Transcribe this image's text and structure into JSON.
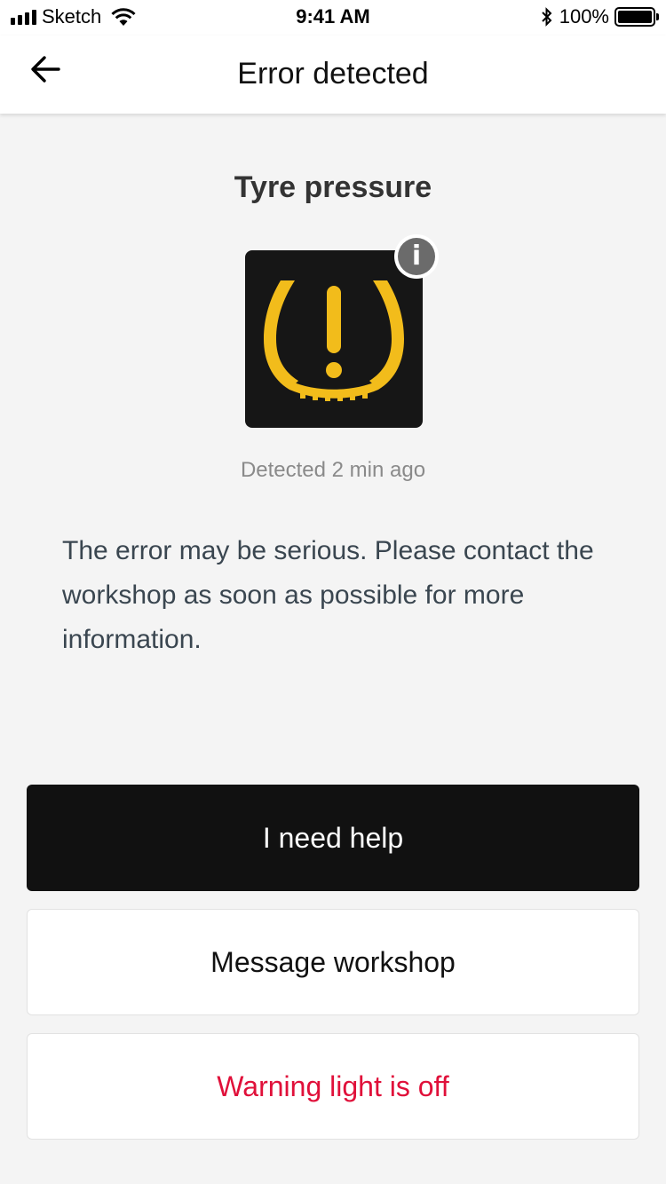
{
  "status_bar": {
    "carrier": "Sketch",
    "time": "9:41 AM",
    "battery": "100%",
    "battery_level": 1.0,
    "icons": [
      "signal-icon",
      "wifi-icon",
      "bluetooth-icon",
      "battery-icon"
    ]
  },
  "nav": {
    "title": "Error detected",
    "back_icon": "arrow-left-icon"
  },
  "error": {
    "title": "Tyre pressure",
    "icon": "tyre-pressure-warning-icon",
    "info_icon": "info-icon",
    "info_glyph": "i",
    "detected": "Detected 2 min ago",
    "message": "The error may be serious. Please contact the workshop as soon as possible for more information."
  },
  "actions": {
    "help_label": "I need help",
    "message_label": "Message workshop",
    "off_label": "Warning light is off"
  },
  "colors": {
    "warning_yellow": "#f2bc1b",
    "alert_red": "#e0103a",
    "primary_dark": "#111111",
    "background": "#f4f4f4"
  }
}
